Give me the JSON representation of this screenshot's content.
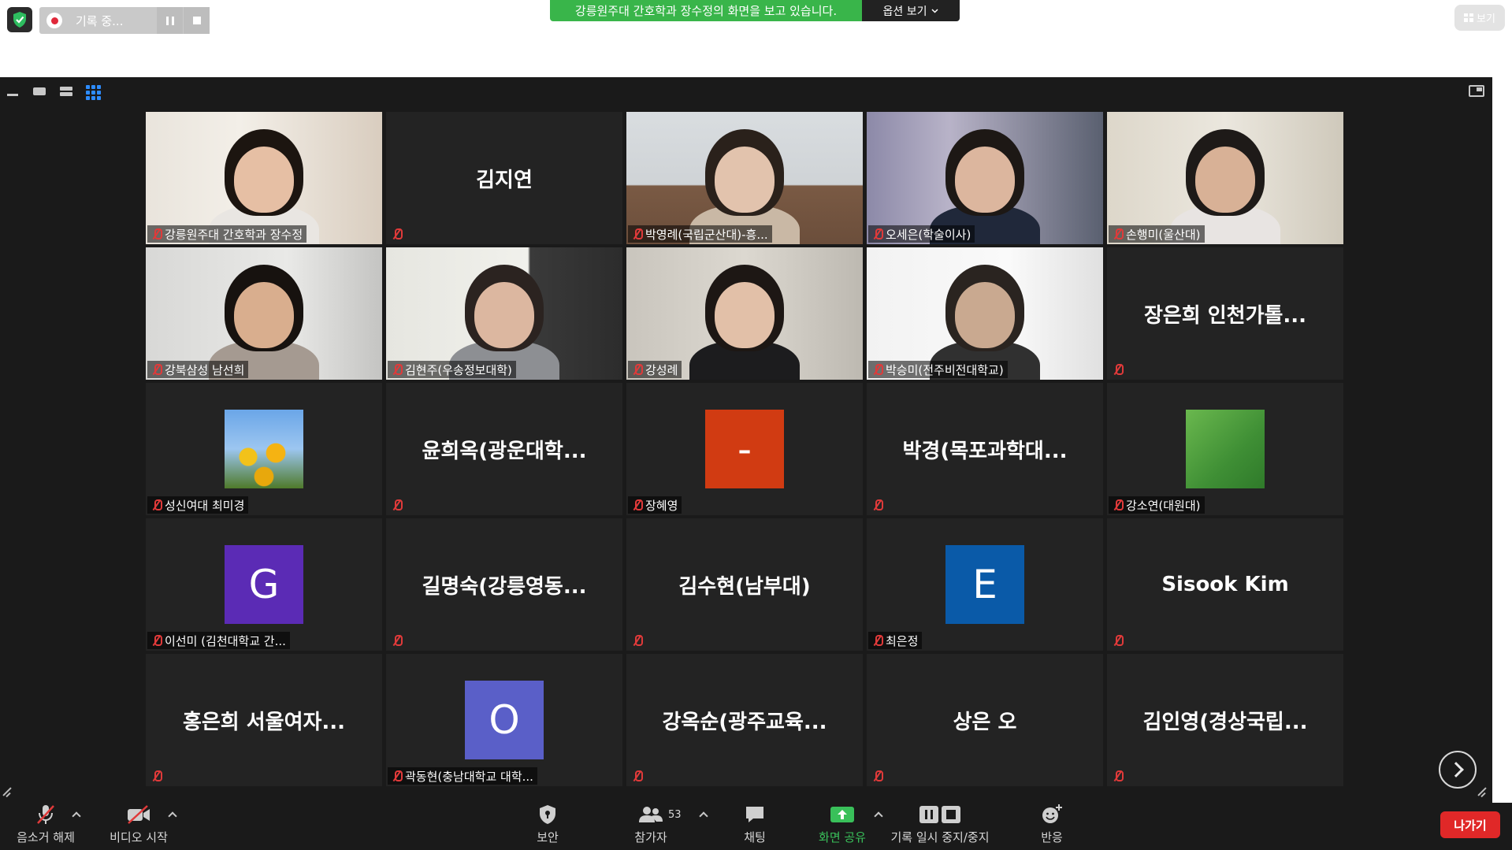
{
  "recording": {
    "label": "기록 중..."
  },
  "share_banner": {
    "text": "강릉원주대 간호학과 장수정의 화면을 보고 있습니다.",
    "options_label": "옵션 보기"
  },
  "view_button": {
    "label": "보기"
  },
  "tiles": [
    {
      "label": "강릉원주대 간호학과 장수정",
      "name": "",
      "kind": "video",
      "active": true
    },
    {
      "label": "",
      "name": "김지연",
      "kind": "name"
    },
    {
      "label": "박영례(국립군산대)-흥...",
      "name": "",
      "kind": "video"
    },
    {
      "label": "오세은(학술이사)",
      "name": "",
      "kind": "video"
    },
    {
      "label": "손행미(울산대)",
      "name": "",
      "kind": "video"
    },
    {
      "label": "강북삼성 남선희",
      "name": "",
      "kind": "video"
    },
    {
      "label": "김현주(우송정보대학)",
      "name": "",
      "kind": "video"
    },
    {
      "label": "강성례",
      "name": "",
      "kind": "video"
    },
    {
      "label": "박승미(전주비전대학교)",
      "name": "",
      "kind": "video"
    },
    {
      "label": "",
      "name": "장은희 인천가톨...",
      "kind": "name"
    },
    {
      "label": "성신여대 최미경",
      "name": "",
      "kind": "avatar-photo"
    },
    {
      "label": "",
      "name": "윤희옥(광운대학...",
      "kind": "name"
    },
    {
      "label": "장혜영",
      "name": "",
      "kind": "avatar",
      "letter": "-",
      "color": "#d13b12"
    },
    {
      "label": "",
      "name": "박경(목포과학대...",
      "kind": "name"
    },
    {
      "label": "강소연(대원대)",
      "name": "",
      "kind": "avatar-green"
    },
    {
      "label": "이선미 (김천대학교 간...",
      "name": "",
      "kind": "avatar",
      "letter": "G",
      "color": "#5b2bb5"
    },
    {
      "label": "",
      "name": "길명숙(강릉영동...",
      "kind": "name"
    },
    {
      "label": "",
      "name": "김수현(남부대)",
      "kind": "name"
    },
    {
      "label": "최은정",
      "name": "",
      "kind": "avatar",
      "letter": "E",
      "color": "#0a5aa8"
    },
    {
      "label": "",
      "name": "Sisook Kim",
      "kind": "name"
    },
    {
      "label": "",
      "name": "홍은희 서울여자...",
      "kind": "name"
    },
    {
      "label": "곽동현(충남대학교 대학...",
      "name": "",
      "kind": "avatar",
      "letter": "O",
      "color": "#5a5fc8"
    },
    {
      "label": "",
      "name": "강옥순(광주교육...",
      "kind": "name"
    },
    {
      "label": "",
      "name": "상은 오",
      "kind": "name"
    },
    {
      "label": "",
      "name": "김인영(경상국립...",
      "kind": "name"
    }
  ],
  "toolbar": {
    "unmute": "음소거 해제",
    "start_video": "비디오 시작",
    "security": "보안",
    "participants": "참가자",
    "participant_count": "53",
    "chat": "채팅",
    "share_screen": "화면 공유",
    "record_pause_stop": "기록 일시 중지/중지",
    "reactions": "반응",
    "leave": "나가기"
  },
  "colors": {
    "share_green": "#39b54a",
    "accent_blue": "#2d8cff",
    "leave_red": "#e02828",
    "active_speaker": "#d8e24f"
  }
}
